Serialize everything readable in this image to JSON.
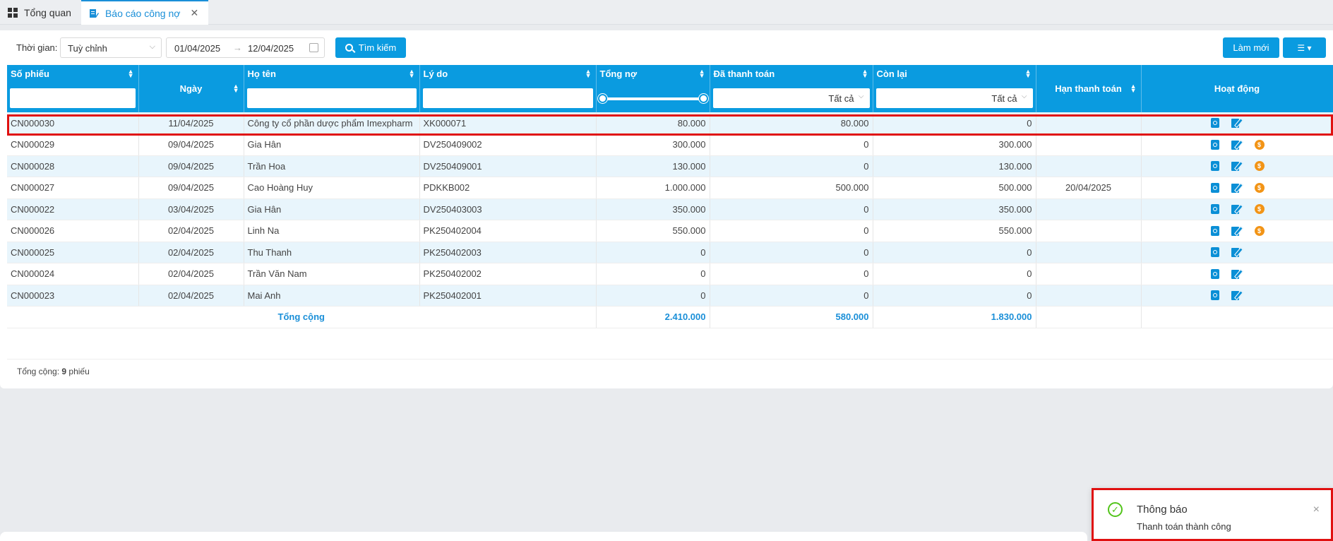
{
  "tabs": [
    {
      "label": "Tổng quan",
      "icon": "dashboard-icon",
      "active": false
    },
    {
      "label": "Báo cáo công nợ",
      "icon": "report-edit-icon",
      "active": true
    }
  ],
  "toolbar": {
    "time_label": "Thời gian:",
    "time_select": "Tuỳ chỉnh",
    "date_from": "01/04/2025",
    "date_to": "12/04/2025",
    "search_label": "Tìm kiếm",
    "refresh_label": "Làm mới"
  },
  "table": {
    "headers": {
      "so_phieu": "Số phiếu",
      "ngay": "Ngày",
      "ho_ten": "Họ tên",
      "ly_do": "Lý do",
      "tong_no": "Tổng nợ",
      "da_thanh_toan": "Đã thanh toán",
      "con_lai": "Còn lại",
      "han_thanh_toan": "Hạn thanh toán",
      "hoat_dong": "Hoạt động"
    },
    "filter_all": "Tất cả",
    "rows": [
      {
        "so_phieu": "CN000030",
        "ngay": "11/04/2025",
        "ho_ten": "Công ty cổ phần dược phẩm Imexpharm",
        "ly_do": "XK000071",
        "tong_no": "80.000",
        "da_thanh_toan": "80.000",
        "con_lai": "0",
        "han": "",
        "pay": false
      },
      {
        "so_phieu": "CN000029",
        "ngay": "09/04/2025",
        "ho_ten": "Gia Hân",
        "ly_do": "DV250409002",
        "tong_no": "300.000",
        "da_thanh_toan": "0",
        "con_lai": "300.000",
        "han": "",
        "pay": true
      },
      {
        "so_phieu": "CN000028",
        "ngay": "09/04/2025",
        "ho_ten": "Trần Hoa",
        "ly_do": "DV250409001",
        "tong_no": "130.000",
        "da_thanh_toan": "0",
        "con_lai": "130.000",
        "han": "",
        "pay": true
      },
      {
        "so_phieu": "CN000027",
        "ngay": "09/04/2025",
        "ho_ten": "Cao Hoàng Huy",
        "ly_do": "PDKKB002",
        "tong_no": "1.000.000",
        "da_thanh_toan": "500.000",
        "con_lai": "500.000",
        "han": "20/04/2025",
        "pay": true
      },
      {
        "so_phieu": "CN000022",
        "ngay": "03/04/2025",
        "ho_ten": "Gia Hân",
        "ly_do": "DV250403003",
        "tong_no": "350.000",
        "da_thanh_toan": "0",
        "con_lai": "350.000",
        "han": "",
        "pay": true
      },
      {
        "so_phieu": "CN000026",
        "ngay": "02/04/2025",
        "ho_ten": "Linh Na",
        "ly_do": "PK250402004",
        "tong_no": "550.000",
        "da_thanh_toan": "0",
        "con_lai": "550.000",
        "han": "",
        "pay": true
      },
      {
        "so_phieu": "CN000025",
        "ngay": "02/04/2025",
        "ho_ten": "Thu Thanh",
        "ly_do": "PK250402003",
        "tong_no": "0",
        "da_thanh_toan": "0",
        "con_lai": "0",
        "han": "",
        "pay": false
      },
      {
        "so_phieu": "CN000024",
        "ngay": "02/04/2025",
        "ho_ten": "Trần Văn Nam",
        "ly_do": "PK250402002",
        "tong_no": "0",
        "da_thanh_toan": "0",
        "con_lai": "0",
        "han": "",
        "pay": false
      },
      {
        "so_phieu": "CN000023",
        "ngay": "02/04/2025",
        "ho_ten": "Mai Anh",
        "ly_do": "PK250402001",
        "tong_no": "0",
        "da_thanh_toan": "0",
        "con_lai": "0",
        "han": "",
        "pay": false
      }
    ],
    "total": {
      "label": "Tổng cộng",
      "tong_no": "2.410.000",
      "da_thanh_toan": "580.000",
      "con_lai": "1.830.000"
    }
  },
  "summary": {
    "prefix": "Tổng cộng:",
    "count": "9",
    "unit": "phiếu"
  },
  "notification": {
    "title": "Thông báo",
    "message": "Thanh toán thành công"
  },
  "colors": {
    "primary": "#0a9be0",
    "highlight_border": "#e01010",
    "success": "#52c41a",
    "pay_icon": "#f29416"
  }
}
